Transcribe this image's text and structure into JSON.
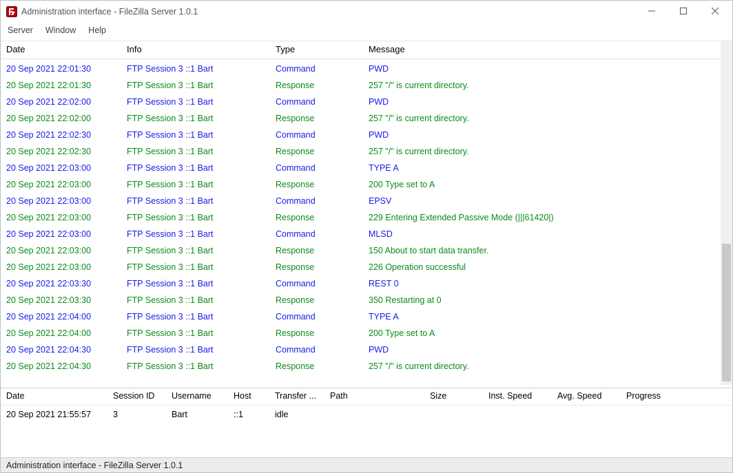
{
  "window": {
    "title": "Administration interface - FileZilla Server 1.0.1"
  },
  "menu": {
    "server": "Server",
    "window": "Window",
    "help": "Help"
  },
  "log": {
    "headers": {
      "date": "Date",
      "info": "Info",
      "type": "Type",
      "message": "Message"
    },
    "rows": [
      {
        "date": "20 Sep 2021 22:01:30",
        "info": "FTP Session 3 ::1 Bart",
        "type": "Command",
        "kind": "command",
        "message": "PWD"
      },
      {
        "date": "20 Sep 2021 22:01:30",
        "info": "FTP Session 3 ::1 Bart",
        "type": "Response",
        "kind": "response",
        "message": "257 \"/\" is current directory."
      },
      {
        "date": "20 Sep 2021 22:02:00",
        "info": "FTP Session 3 ::1 Bart",
        "type": "Command",
        "kind": "command",
        "message": "PWD"
      },
      {
        "date": "20 Sep 2021 22:02:00",
        "info": "FTP Session 3 ::1 Bart",
        "type": "Response",
        "kind": "response",
        "message": "257 \"/\" is current directory."
      },
      {
        "date": "20 Sep 2021 22:02:30",
        "info": "FTP Session 3 ::1 Bart",
        "type": "Command",
        "kind": "command",
        "message": "PWD"
      },
      {
        "date": "20 Sep 2021 22:02:30",
        "info": "FTP Session 3 ::1 Bart",
        "type": "Response",
        "kind": "response",
        "message": "257 \"/\" is current directory."
      },
      {
        "date": "20 Sep 2021 22:03:00",
        "info": "FTP Session 3 ::1 Bart",
        "type": "Command",
        "kind": "command",
        "message": "TYPE A"
      },
      {
        "date": "20 Sep 2021 22:03:00",
        "info": "FTP Session 3 ::1 Bart",
        "type": "Response",
        "kind": "response",
        "message": "200 Type set to A"
      },
      {
        "date": "20 Sep 2021 22:03:00",
        "info": "FTP Session 3 ::1 Bart",
        "type": "Command",
        "kind": "command",
        "message": "EPSV"
      },
      {
        "date": "20 Sep 2021 22:03:00",
        "info": "FTP Session 3 ::1 Bart",
        "type": "Response",
        "kind": "response",
        "message": "229 Entering Extended Passive Mode (|||61420|)"
      },
      {
        "date": "20 Sep 2021 22:03:00",
        "info": "FTP Session 3 ::1 Bart",
        "type": "Command",
        "kind": "command",
        "message": "MLSD"
      },
      {
        "date": "20 Sep 2021 22:03:00",
        "info": "FTP Session 3 ::1 Bart",
        "type": "Response",
        "kind": "response",
        "message": "150 About to start data transfer."
      },
      {
        "date": "20 Sep 2021 22:03:00",
        "info": "FTP Session 3 ::1 Bart",
        "type": "Response",
        "kind": "response",
        "message": "226 Operation successful"
      },
      {
        "date": "20 Sep 2021 22:03:30",
        "info": "FTP Session 3 ::1 Bart",
        "type": "Command",
        "kind": "command",
        "message": "REST 0"
      },
      {
        "date": "20 Sep 2021 22:03:30",
        "info": "FTP Session 3 ::1 Bart",
        "type": "Response",
        "kind": "response",
        "message": "350 Restarting at 0"
      },
      {
        "date": "20 Sep 2021 22:04:00",
        "info": "FTP Session 3 ::1 Bart",
        "type": "Command",
        "kind": "command",
        "message": "TYPE A"
      },
      {
        "date": "20 Sep 2021 22:04:00",
        "info": "FTP Session 3 ::1 Bart",
        "type": "Response",
        "kind": "response",
        "message": "200 Type set to A"
      },
      {
        "date": "20 Sep 2021 22:04:30",
        "info": "FTP Session 3 ::1 Bart",
        "type": "Command",
        "kind": "command",
        "message": "PWD"
      },
      {
        "date": "20 Sep 2021 22:04:30",
        "info": "FTP Session 3 ::1 Bart",
        "type": "Response",
        "kind": "response",
        "message": "257 \"/\" is current directory."
      }
    ]
  },
  "sessions": {
    "headers": {
      "date": "Date",
      "session_id": "Session ID",
      "username": "Username",
      "host": "Host",
      "transfer": "Transfer ...",
      "path": "Path",
      "size": "Size",
      "inst_speed": "Inst. Speed",
      "avg_speed": "Avg. Speed",
      "progress": "Progress"
    },
    "rows": [
      {
        "date": "20 Sep 2021 21:55:57",
        "session_id": "3",
        "username": "Bart",
        "host": "::1",
        "transfer": "idle",
        "path": "",
        "size": "",
        "inst_speed": "",
        "avg_speed": "",
        "progress": ""
      }
    ]
  },
  "statusbar": {
    "text": "Administration interface - FileZilla Server 1.0.1"
  }
}
